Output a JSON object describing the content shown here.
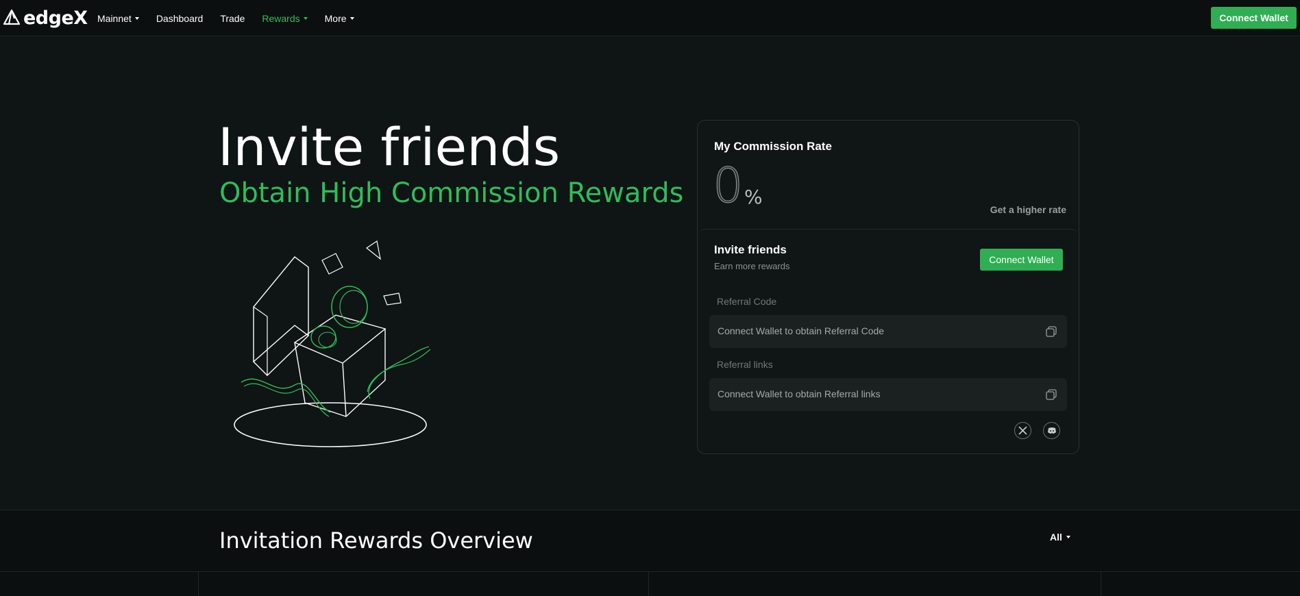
{
  "brand": {
    "logo_text": "edgeX"
  },
  "nav": {
    "items": [
      {
        "label": "Mainnet",
        "has_caret": true
      },
      {
        "label": "Dashboard",
        "has_caret": false
      },
      {
        "label": "Trade",
        "has_caret": false
      },
      {
        "label": "Rewards",
        "has_caret": true,
        "active": true
      },
      {
        "label": "More",
        "has_caret": true
      }
    ],
    "connect_wallet": "Connect Wallet"
  },
  "hero": {
    "title": "Invite friends",
    "subtitle": "Obtain High Commission Rewards"
  },
  "commission": {
    "title": "My Commission Rate",
    "value": "0",
    "unit": "%",
    "higher_rate_link": "Get a higher rate"
  },
  "invite": {
    "title": "Invite friends",
    "subtitle": "Earn more rewards",
    "connect_wallet": "Connect Wallet",
    "referral_code_label": "Referral Code",
    "referral_code_value": "Connect Wallet to obtain Referral Code",
    "referral_links_label": "Referral links",
    "referral_links_value": "Connect Wallet to obtain Referral links",
    "social_icons": [
      "x-icon",
      "discord-icon"
    ]
  },
  "overview": {
    "title": "Invitation Rewards Overview",
    "filter": "All"
  },
  "colors": {
    "accent": "#2fbd5a",
    "button": "#2fae53",
    "background": "#0f1414"
  }
}
